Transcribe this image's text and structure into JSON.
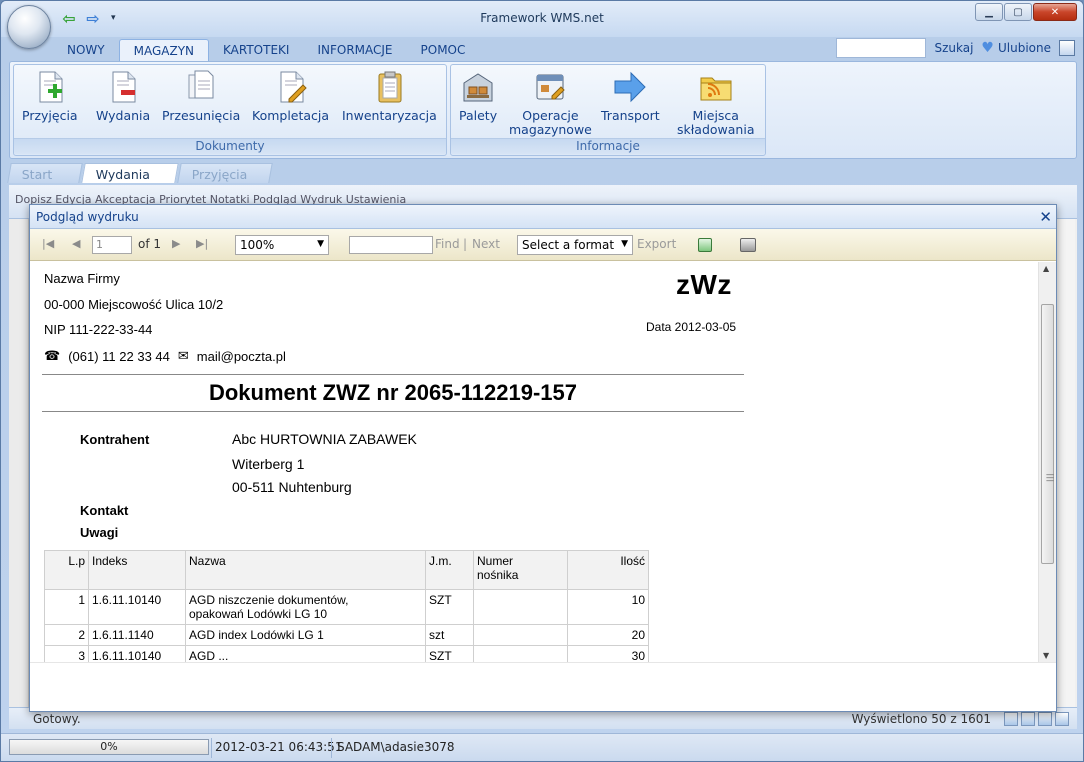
{
  "window": {
    "title": "Framework WMS.net"
  },
  "ribbon": {
    "tabs": [
      "NOWY",
      "MAGAZYN",
      "KARTOTEKI",
      "INFORMACJE",
      "POMOC"
    ],
    "search_label": "Szukaj",
    "favorites_label": "Ulubione",
    "groups": {
      "dokumenty": {
        "label": "Dokumenty",
        "buttons": [
          "Przyjęcia",
          "Wydania",
          "Przesunięcia",
          "Kompletacja",
          "Inwentaryzacja"
        ]
      },
      "informacje": {
        "label": "Informacje",
        "buttons": [
          "Palety",
          "Operacje\nmagazynowe",
          "Transport",
          "Miejsca\nskładowania"
        ],
        "buttons_lines": [
          [
            "Palety"
          ],
          [
            "Operacje",
            "magazynowe"
          ],
          [
            "Transport"
          ],
          [
            "Miejsca",
            "składowania"
          ]
        ]
      }
    }
  },
  "doc_tabs": [
    "Start",
    "Wydania",
    "Przyjęcia"
  ],
  "background_toolbar": "Dopisz   Edycja   Akceptacja   Priorytet   Notatki   Podgląd   Wydruk   Ustawienia",
  "dialog": {
    "title": "Podgląd wydruku",
    "toolbar": {
      "page_value": "1",
      "of_pages": "of 1",
      "zoom": "100%",
      "find": "Find",
      "separator": "|",
      "next": "Next",
      "format": "Select a format",
      "export": "Export"
    },
    "report": {
      "company_name": "Nazwa Firmy",
      "address": "00-000 Miejscowość Ulica 10/2",
      "nip": "NIP 111-222-33-44",
      "phone": "(061) 11 22 33 44",
      "email": "mail@poczta.pl",
      "code": "zWz",
      "date": "Data 2012-03-05",
      "doc_title": "Dokument ZWZ nr 2065-112219-157",
      "contractor_label": "Kontrahent",
      "contractor_lines": [
        "Abc HURTOWNIA ZABAWEK",
        "Witerberg 1",
        "00-511 Nuhtenburg"
      ],
      "contact_label": "Kontakt",
      "notes_label": "Uwagi",
      "table": {
        "headers": [
          "L.p",
          "Indeks",
          "Nazwa",
          "J.m.",
          "Numer nośnika",
          "Ilość"
        ],
        "header_nosnik": [
          "Numer",
          "nośnika"
        ],
        "rows": [
          {
            "lp": "1",
            "indeks": "1.6.11.10140",
            "nazwa": [
              "AGD niszczenie dokumentów,",
              "opakowań Lodówki LG 10"
            ],
            "jm": "SZT",
            "nosnik": "",
            "ilosc": "10"
          },
          {
            "lp": "2",
            "indeks": "1.6.11.1140",
            "nazwa": [
              "AGD index Lodówki LG 1"
            ],
            "jm": "szt",
            "nosnik": "",
            "ilosc": "20"
          },
          {
            "lp": "3",
            "indeks": "1.6.11.10140",
            "nazwa": [
              "AGD ..."
            ],
            "jm": "SZT",
            "nosnik": "",
            "ilosc": "30"
          }
        ]
      }
    }
  },
  "status": {
    "ready": "Gotowy.",
    "shown": "Wyświetlono 50 z 1601",
    "progress": "0%",
    "datetime": "2012-03-21 06:43:51",
    "user": "SADAM\\adasie3078"
  }
}
